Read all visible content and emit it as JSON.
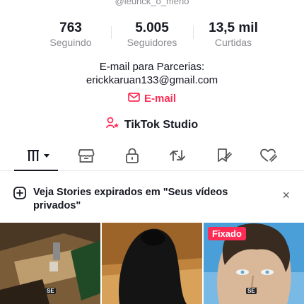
{
  "profile": {
    "handle": "@leurick_o_meno",
    "stats": [
      {
        "value": "763",
        "label": "Seguindo"
      },
      {
        "value": "5.005",
        "label": "Seguidores"
      },
      {
        "value": "13,5 mil",
        "label": "Curtidas"
      }
    ],
    "bio_line1": "E-mail para Parcerias:",
    "bio_line2": "erickkaruan133@gmail.com",
    "email_button": "E-mail",
    "studio_label": "TikTok Studio"
  },
  "tabs": [
    {
      "icon": "videos-grid-icon",
      "active": true
    },
    {
      "icon": "shop-icon"
    },
    {
      "icon": "lock-icon"
    },
    {
      "icon": "repost-icon"
    },
    {
      "icon": "favorites-icon"
    },
    {
      "icon": "liked-icon"
    }
  ],
  "banner": {
    "text": "Veja Stories expirados em \"Seus vídeos privados\"",
    "close": "×"
  },
  "videos": [
    {
      "pinned": false,
      "tag": "SE"
    },
    {
      "pinned": false,
      "tag": ""
    },
    {
      "pinned": true,
      "pinned_label": "Fixado",
      "tag": "SE"
    }
  ],
  "colors": {
    "accent": "#fe2c55",
    "text": "#161823",
    "muted": "#8a8b91"
  }
}
